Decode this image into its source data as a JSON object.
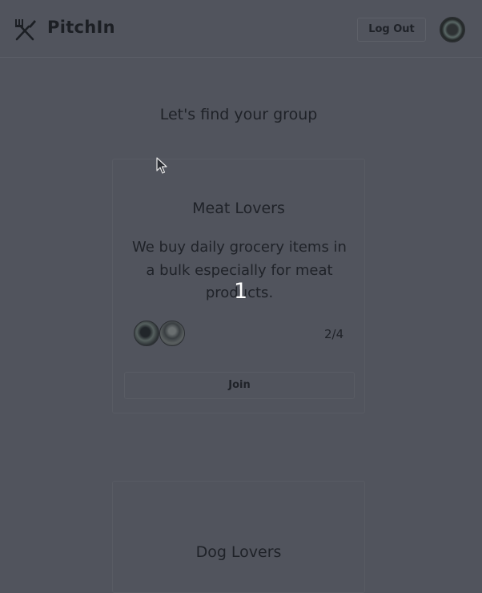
{
  "header": {
    "brand": "PitchIn",
    "logout_label": "Log Out"
  },
  "main": {
    "heading": "Let's find your group"
  },
  "groups": [
    {
      "title": "Meat Lovers",
      "description": "We buy daily grocery items in a bulk especially for meat products.",
      "members": "2/4",
      "join_label": "Join"
    },
    {
      "title": "Dog Lovers"
    }
  ],
  "overlay": {
    "number": "1"
  }
}
